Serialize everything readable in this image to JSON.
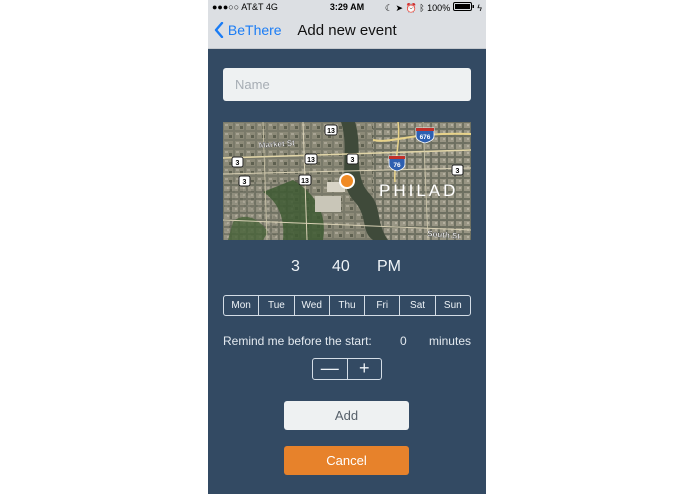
{
  "status_bar": {
    "signal": "●●●○○",
    "carrier": "AT&T",
    "network": "4G",
    "time": "3:29 AM",
    "battery": "100%"
  },
  "nav": {
    "back_label": "BeThere",
    "title": "Add new event"
  },
  "form": {
    "name_placeholder": "Name",
    "name_value": ""
  },
  "map": {
    "city_label": "PHILAD",
    "streets": [
      "Market St",
      "South St"
    ],
    "route_shields": [
      "13",
      "3",
      "3",
      "13",
      "3",
      "13",
      "3"
    ],
    "interstates": [
      "676",
      "76"
    ]
  },
  "time": {
    "hour": "3",
    "minute": "40",
    "period": "PM"
  },
  "days": [
    "Mon",
    "Tue",
    "Wed",
    "Thu",
    "Fri",
    "Sat",
    "Sun"
  ],
  "reminder": {
    "label": "Remind me before the start:",
    "value": "0",
    "unit": "minutes",
    "decrement": "—",
    "increment": "+"
  },
  "buttons": {
    "add": "Add",
    "cancel": "Cancel"
  },
  "colors": {
    "background": "#334a63",
    "nav_bar": "#dcdfe3",
    "accent_link": "#1a7cf5",
    "cancel": "#e7822b",
    "location_pin": "#f08a24"
  }
}
